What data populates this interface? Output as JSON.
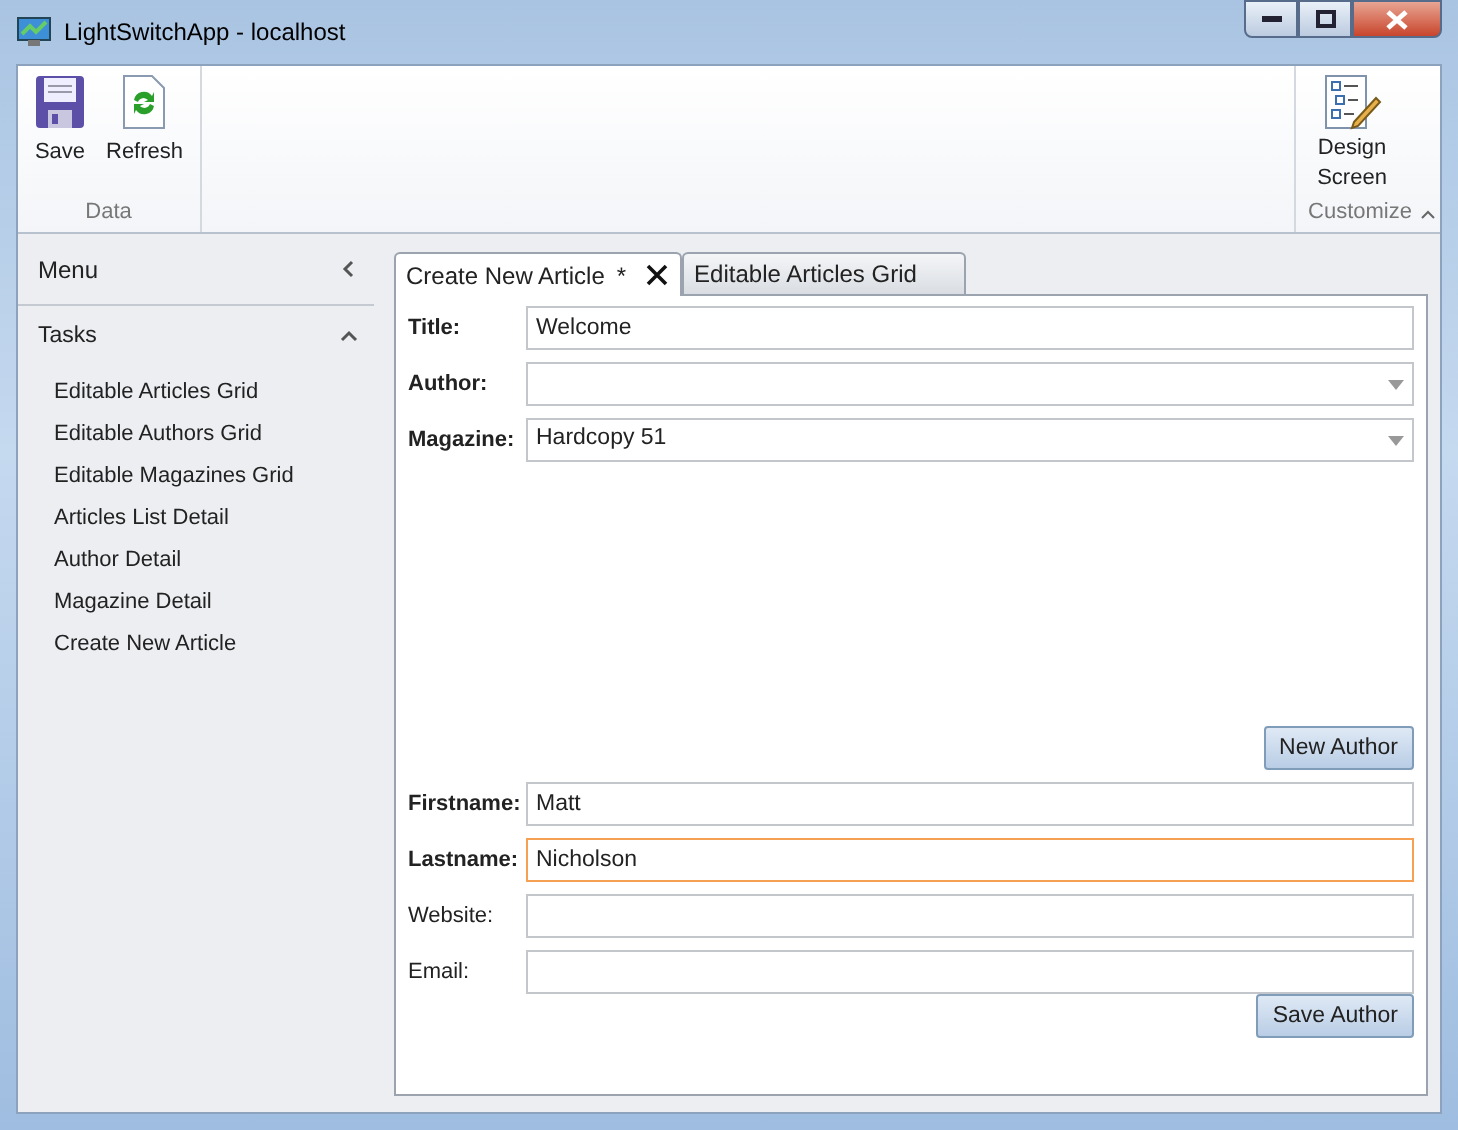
{
  "window": {
    "title": "LightSwitchApp - localhost"
  },
  "ribbon": {
    "groups": [
      {
        "label": "Data",
        "buttons": [
          {
            "kind": "save",
            "label": "Save"
          },
          {
            "kind": "refresh",
            "label": "Refresh"
          }
        ]
      },
      {
        "label": "Customize",
        "buttons": [
          {
            "kind": "design",
            "label": "Design Screen"
          }
        ]
      }
    ]
  },
  "sidebar": {
    "title": "Menu",
    "section": "Tasks",
    "expanded": true,
    "items": [
      {
        "label": "Editable Articles Grid"
      },
      {
        "label": "Editable Authors Grid"
      },
      {
        "label": "Editable Magazines Grid"
      },
      {
        "label": "Articles List Detail"
      },
      {
        "label": "Author Detail"
      },
      {
        "label": "Magazine Detail"
      },
      {
        "label": "Create New Article"
      }
    ]
  },
  "tabs": [
    {
      "label": "Create New Article",
      "dirty_mark": "*",
      "selected": true
    },
    {
      "label": "Editable Articles Grid",
      "selected": false
    }
  ],
  "article_fields": [
    {
      "label": "Title:",
      "value": "Welcome",
      "kind": "text",
      "required": true,
      "focused": false
    },
    {
      "label": "Author:",
      "kind": "dropdown",
      "required": true,
      "focused": false
    },
    {
      "label": "Magazine:",
      "value": "Hardcopy 51",
      "kind": "dropdown",
      "required": true,
      "focused": false
    }
  ],
  "new_author_button": "New Author",
  "author_fields": [
    {
      "label": "Firstname:",
      "value": "Matt",
      "kind": "text",
      "required": true,
      "focused": false
    },
    {
      "label": "Lastname:",
      "value": "Nicholson",
      "kind": "text",
      "required": true,
      "focused": true
    },
    {
      "label": "Website:",
      "kind": "text",
      "required": false,
      "focused": false
    },
    {
      "label": "Email:",
      "kind": "text",
      "required": false,
      "focused": false
    }
  ],
  "save_author_button": "Save Author"
}
